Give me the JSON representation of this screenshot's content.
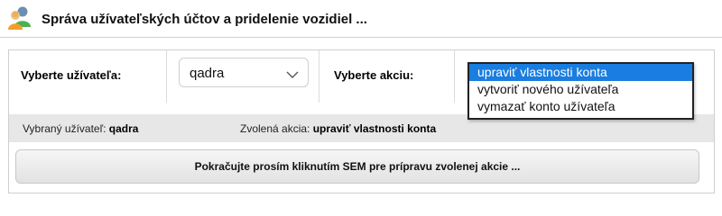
{
  "header": {
    "title": "Správa užívateľských účtov a pridelenie vozidiel ...",
    "icon": "users-icon"
  },
  "form": {
    "user_label": "Vyberte užívateľa:",
    "user_value": "qadra",
    "action_label": "Vyberte akciu:",
    "action_options": [
      "upraviť vlastnosti konta",
      "vytvoriť nového užívateľa",
      "vymazať konto užívateľa"
    ],
    "selected_action_index": 0
  },
  "status": {
    "selected_user_label": "Vybraný užívateľ:",
    "selected_user_value": "qadra",
    "chosen_action_label": "Zvolená akcia:",
    "chosen_action_value": "upraviť vlastnosti konta"
  },
  "cta": {
    "label": "Pokračujte prosím kliknutím SEM pre prípravu zvolenej akcie ..."
  },
  "colors": {
    "selection": "#1a7de0",
    "status_bar": "#e7e7e7",
    "icon_green": "#4caf50",
    "icon_orange": "#f0a02a"
  }
}
